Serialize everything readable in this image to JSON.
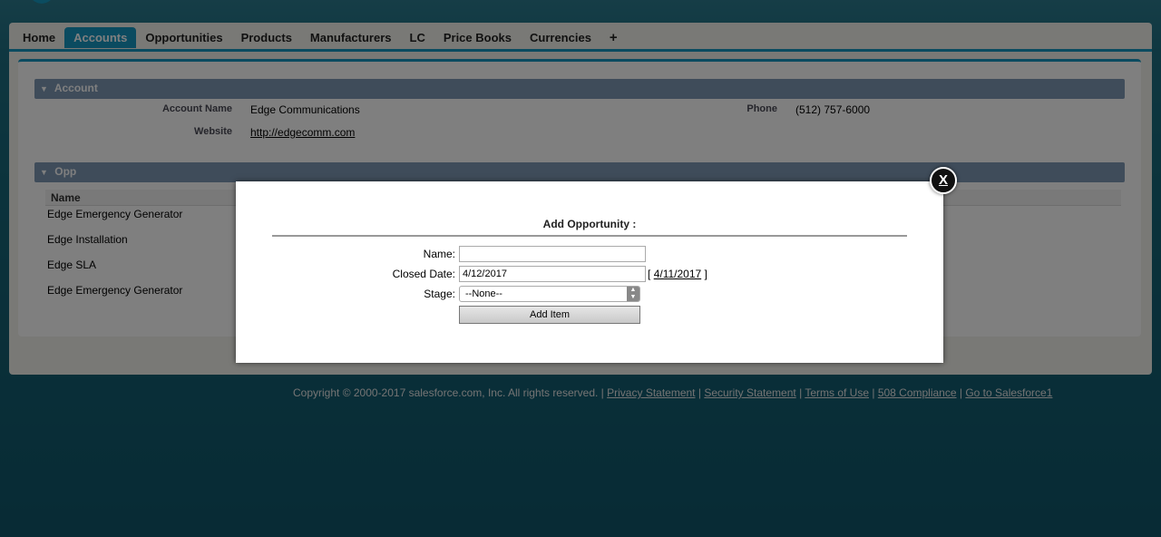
{
  "tabs": [
    "Home",
    "Accounts",
    "Opportunities",
    "Products",
    "Manufacturers",
    "LC",
    "Price Books",
    "Currencies"
  ],
  "tab_plus": "+",
  "account_section": {
    "title": "Account",
    "account_name_label": "Account Name",
    "account_name_value": "Edge Communications",
    "phone_label": "Phone",
    "phone_value": "(512) 757-6000",
    "website_label": "Website",
    "website_value": "http://edgecomm.com"
  },
  "opp_section": {
    "title": "Opp",
    "column_name": "Name",
    "rows": [
      "Edge Emergency Generator",
      "Edge Installation",
      "Edge SLA",
      "Edge Emergency Generator"
    ]
  },
  "footer": {
    "copyright": "Copyright © 2000-2017 salesforce.com, Inc. All rights reserved. |",
    "links": [
      "Privacy Statement",
      "Security Statement",
      "Terms of Use",
      "508 Compliance",
      "Go to Salesforce1"
    ],
    "separator": "|"
  },
  "modal": {
    "close_label": "X",
    "title": "Add Opportunity :",
    "name_label": "Name:",
    "name_value": "",
    "closed_date_label": "Closed Date:",
    "closed_date_value": "4/12/2017",
    "today_bracket_open": "[",
    "today_link": "4/11/2017",
    "today_bracket_close": "]",
    "stage_label": "Stage:",
    "stage_selected": "--None--",
    "add_button": "Add Item"
  },
  "colors": {
    "accent": "#1797c0",
    "section_header": "#7f99b4",
    "background": "#1e6e82"
  },
  "icons": [
    "triangle-down-icon",
    "close-icon",
    "select-arrows-icon",
    "plus-icon"
  ]
}
